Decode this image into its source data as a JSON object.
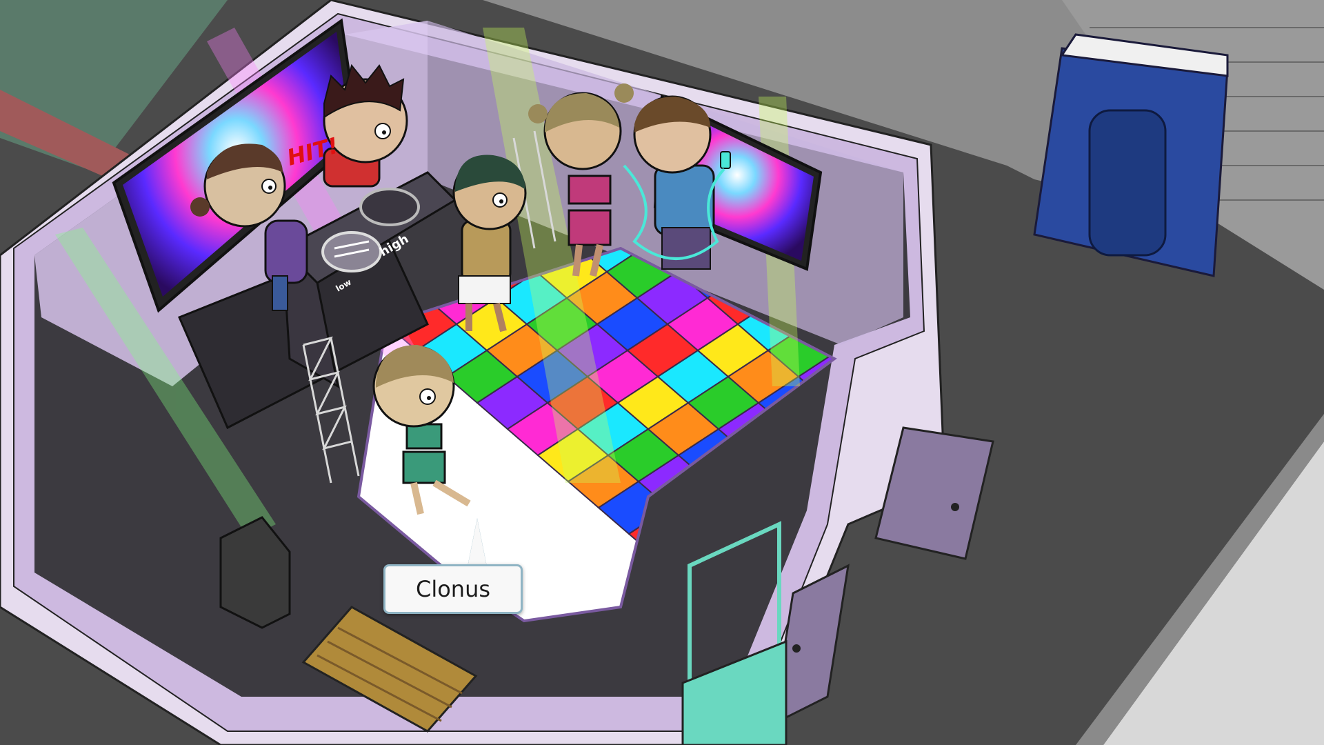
{
  "scene": {
    "callout": {
      "label": "Clonus"
    },
    "dj_mixer": {
      "knob_low_label": "low",
      "knob_high_label": "high"
    },
    "sound_effect": {
      "text": "HIT!"
    },
    "characters": [
      "dj-left",
      "dj-right",
      "dancer-center",
      "dancer-pigtails",
      "dancer-boy-phone",
      "dancer-foreground"
    ],
    "dance_floor": {
      "tile_colors": [
        "#ff2a2a",
        "#ffe81a",
        "#2acc2a",
        "#1a4cff",
        "#ff2ad4",
        "#1ae8ff",
        "#ff8c1a",
        "#8c2aff"
      ]
    },
    "colors": {
      "ground": "#4a4a4a",
      "room_wall": "#d9c8e8",
      "wall_top": "#e6d6f0",
      "door": "#8a7aa0",
      "bench": "#b08a3a",
      "portable_toilet": "#2a4aa0",
      "callout_border": "#8fb4c4"
    }
  }
}
